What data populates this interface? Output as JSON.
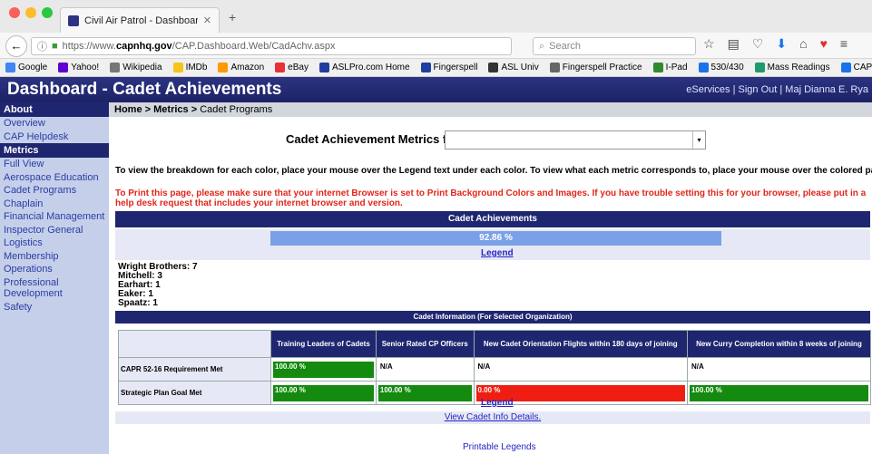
{
  "browser": {
    "tab_title": "Civil Air Patrol - Dashboard ...",
    "url_prefix": "https://www.",
    "url_domain": "capnhq.gov",
    "url_path": "/CAP.Dashboard.Web/CadAchv.aspx",
    "search_placeholder": "Search",
    "bookmarks": [
      "Google",
      "Yahoo!",
      "Wikipedia",
      "IMDb",
      "Amazon",
      "eBay",
      "ASLPro.com Home",
      "Fingerspell",
      "ASL Univ",
      "Fingerspell Practice",
      "I-Pad",
      "530/430",
      "Mass Readings",
      "CAPMail"
    ]
  },
  "header": {
    "title": "Dashboard - Cadet Achievements",
    "links": "eServices | Sign Out | Maj Dianna E. Rya"
  },
  "sidebar": {
    "about_title": "About",
    "about_items": [
      "Overview",
      "CAP Helpdesk"
    ],
    "metrics_title": "Metrics",
    "metrics_items": [
      "Full View",
      "Aerospace Education",
      "Cadet Programs",
      "Chaplain",
      "Financial Management",
      "Inspector General",
      "Logistics",
      "Membership",
      "Operations",
      "Professional Development",
      "Safety"
    ]
  },
  "breadcrumb": {
    "home": "Home",
    "metrics": "Metrics",
    "current": "Cadet Programs",
    "sep": ">"
  },
  "filter": {
    "label": "Cadet Achievement Metrics for:",
    "value": ""
  },
  "instructions": "To view the breakdown for each color, place your mouse over the Legend text under each color. To view what each metric corresponds to, place your mouse over the colored panel itself.",
  "print_note": "To Print this page, please make sure that your internet Browser is set to Print Background Colors and Images. If you have trouble setting this for your browser, please put in a help desk request that includes your internet browser and version.",
  "achievements": {
    "title": "Cadet Achievements",
    "percent": "92.86 %",
    "percent_value": 92.86,
    "legend": "Legend",
    "counts": [
      "Wright Brothers: 7",
      "Mitchell: 3",
      "Earhart: 1",
      "Eaker: 1",
      "Spaatz: 1"
    ]
  },
  "cadet_info": {
    "title": "Cadet Information (For Selected Organization)",
    "columns": [
      "",
      "Training Leaders of Cadets",
      "Senior Rated CP Officers",
      "New Cadet Orientation Flights within 180 days of joining",
      "New Curry Completion within 8 weeks of joining"
    ],
    "rows": [
      {
        "label": "CAPR 52-16 Requirement Met",
        "cells": [
          {
            "text": "100.00 %",
            "status": "green"
          },
          {
            "text": "N/A",
            "status": "none"
          },
          {
            "text": "N/A",
            "status": "none"
          },
          {
            "text": "N/A",
            "status": "none"
          }
        ]
      },
      {
        "label": "Strategic Plan Goal Met",
        "cells": [
          {
            "text": "100.00 %",
            "status": "green"
          },
          {
            "text": "100.00 %",
            "status": "green"
          },
          {
            "text": "0.00 %",
            "status": "red"
          },
          {
            "text": "100.00 %",
            "status": "green"
          }
        ]
      }
    ],
    "legend": "Legend",
    "details_link": "View Cadet Info Details."
  },
  "printable_legends": "Printable Legends",
  "colors": {
    "navy": "#1f2670",
    "green": "#148a0f",
    "red": "#f01e12",
    "bar_blue": "#7aa1e8"
  }
}
